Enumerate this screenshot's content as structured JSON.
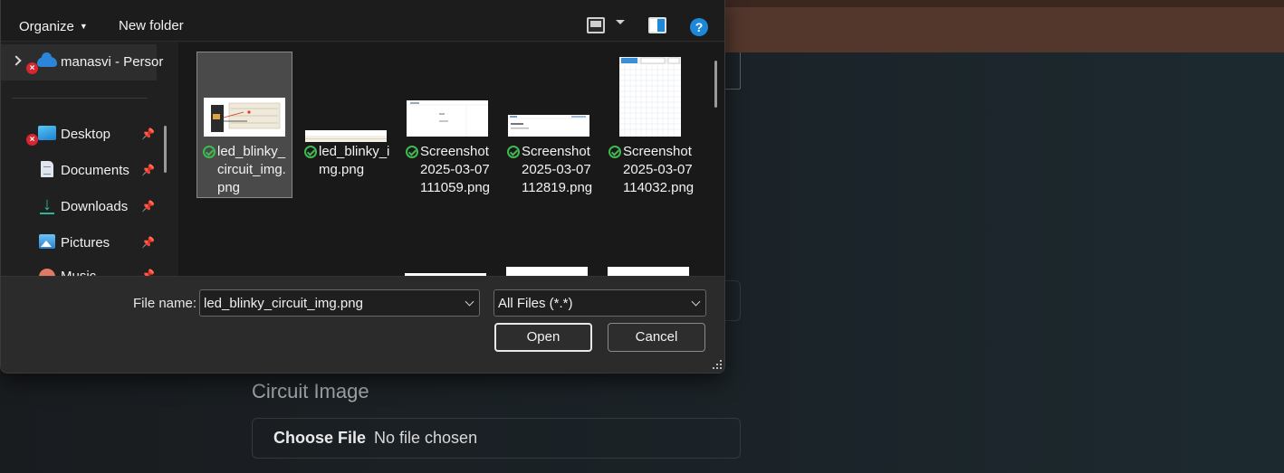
{
  "page": {
    "circuit_label": "Circuit Image",
    "choose_file": "Choose File",
    "no_file": "No file chosen"
  },
  "toolbar": {
    "organize": "Organize",
    "new_folder": "New folder",
    "help": "?"
  },
  "nav": {
    "account": "manasvi - Persor",
    "items": [
      {
        "label": "Desktop",
        "icon": "desktop-icon",
        "pinned": true
      },
      {
        "label": "Documents",
        "icon": "documents-icon",
        "pinned": true
      },
      {
        "label": "Downloads",
        "icon": "downloads-icon",
        "pinned": true
      },
      {
        "label": "Pictures",
        "icon": "pictures-icon",
        "pinned": true
      },
      {
        "label": "Music",
        "icon": "music-icon",
        "pinned": true
      }
    ]
  },
  "files": [
    {
      "name": "led_blinky_circuit_img.png",
      "selected": true
    },
    {
      "name": "led_blinky_img.png",
      "selected": false
    },
    {
      "name": "Screenshot 2025-03-07 111059.png",
      "selected": false
    },
    {
      "name": "Screenshot 2025-03-07 112819.png",
      "selected": false
    },
    {
      "name": "Screenshot 2025-03-07 114032.png",
      "selected": false
    }
  ],
  "bottom": {
    "file_name_label": "File name:",
    "file_name_value": "led_blinky_circuit_img.png",
    "file_type": "All Files (*.*)",
    "open": "Open",
    "cancel": "Cancel"
  },
  "colors": {
    "accent": "#1e88d8",
    "sync_ok": "#3fb950",
    "error": "#d82630"
  }
}
